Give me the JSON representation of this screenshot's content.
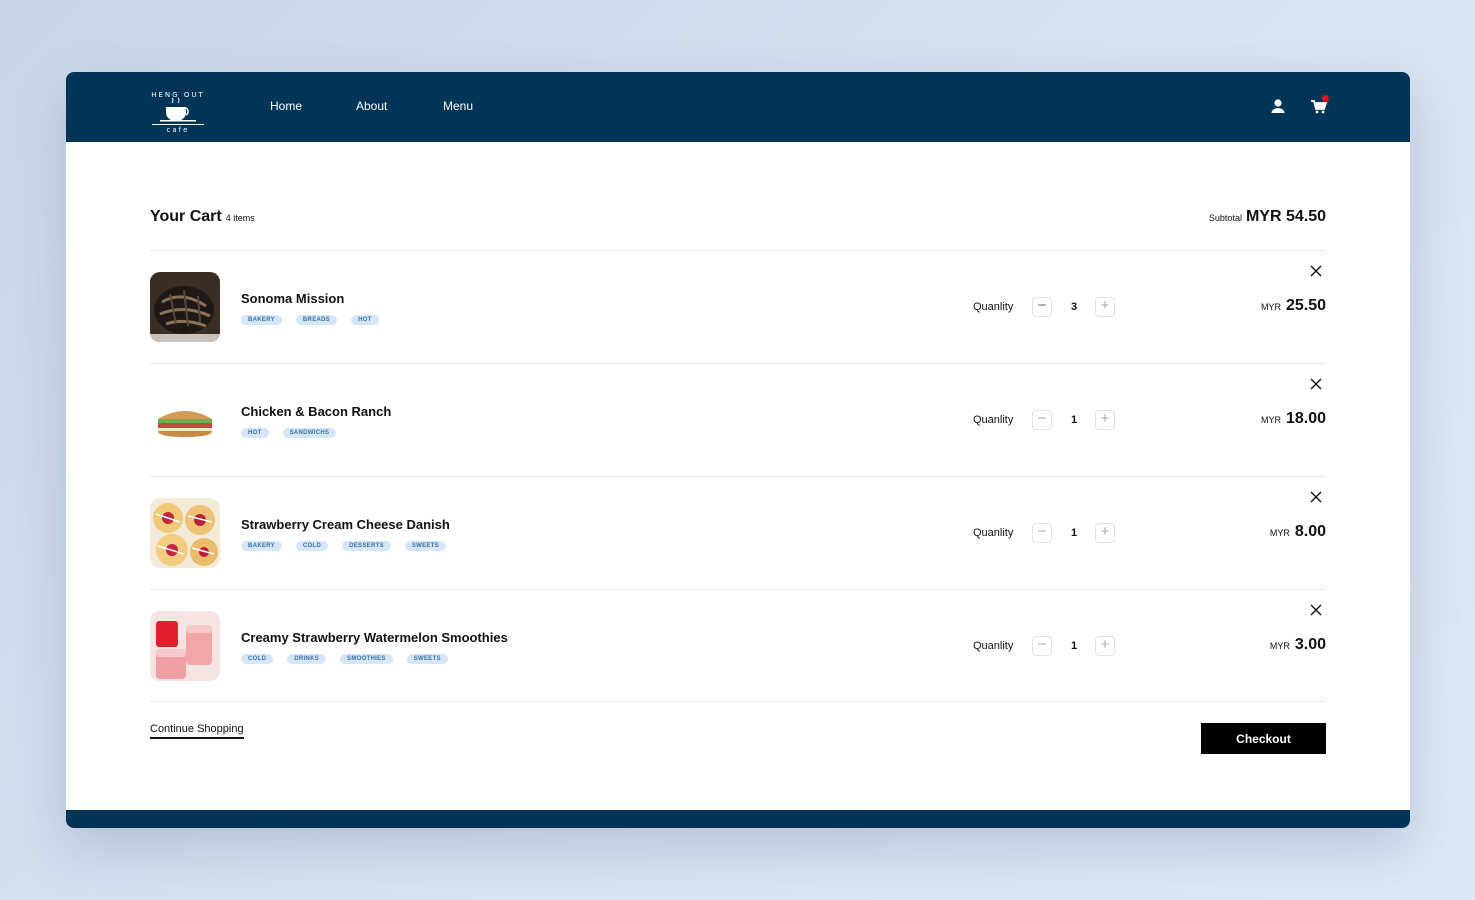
{
  "brand": {
    "logo_top": "HENG OUT",
    "logo_bottom": "cafe"
  },
  "nav": {
    "links": [
      "Home",
      "About",
      "Menu"
    ]
  },
  "cart": {
    "title": "Your Cart",
    "count_label": "4 items",
    "subtotal_label": "Subtotal",
    "subtotal_value": "MYR 54.50",
    "quantity_label": "Quanlity",
    "currency": "MYR",
    "items": [
      {
        "name": "Sonoma Mission",
        "tags": [
          "BAKERY",
          "BREADS",
          "HOT"
        ],
        "quantity": "3",
        "price": "25.50",
        "image": "bread"
      },
      {
        "name": "Chicken & Bacon Ranch",
        "tags": [
          "HOT",
          "SANDWICHS"
        ],
        "quantity": "1",
        "price": "18.00",
        "image": "sandwich"
      },
      {
        "name": "Strawberry Cream Cheese Danish",
        "tags": [
          "BAKERY",
          "COLD",
          "DESSERTS",
          "SWEETS"
        ],
        "quantity": "1",
        "price": "8.00",
        "image": "danish"
      },
      {
        "name": "Creamy Strawberry Watermelon Smoothies",
        "tags": [
          "COLD",
          "DRINKS",
          "SMOOTHIES",
          "SWEETS"
        ],
        "quantity": "1",
        "price": "3.00",
        "image": "smoothie"
      }
    ]
  },
  "actions": {
    "continue_label": "Continue Shopping",
    "checkout_label": "Checkout"
  },
  "colors": {
    "navbar": "#003557",
    "tag_bg": "#d4e6f8",
    "tag_text": "#3a6fa6",
    "checkout_bg": "#000000",
    "cart_badge": "#e0141e"
  },
  "icons": {
    "user": "user-icon",
    "cart": "cart-icon",
    "remove": "close-icon",
    "minus": "minus-icon",
    "plus": "plus-icon"
  }
}
